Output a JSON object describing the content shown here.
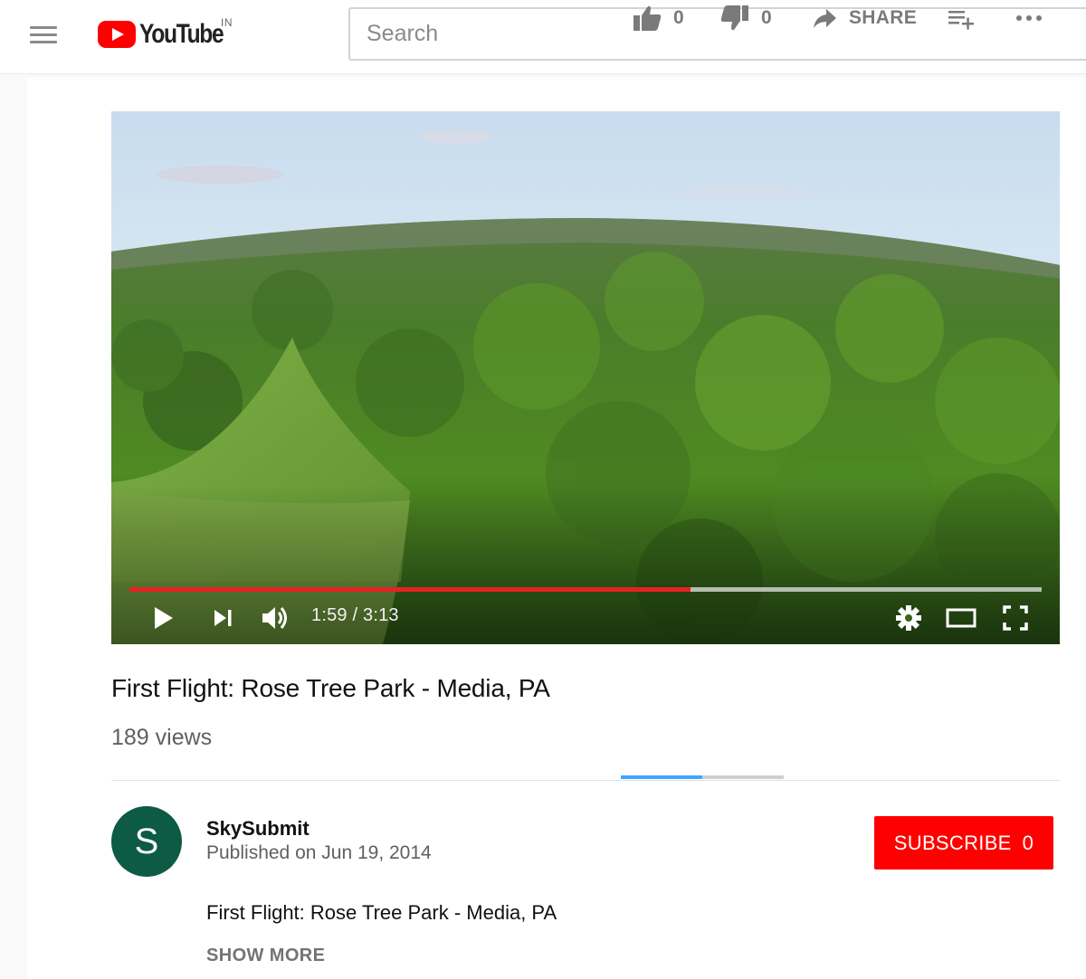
{
  "masthead": {
    "logo_text": "YouTube",
    "country_code": "IN",
    "search_placeholder": "Search"
  },
  "player": {
    "current_time": "1:59",
    "duration": "3:13",
    "time_display": "1:59 / 3:13",
    "progress_fraction": 0.615,
    "controls": [
      "play-icon",
      "next-icon",
      "volume-icon",
      "gear-icon",
      "theater-icon",
      "fullscreen-icon"
    ]
  },
  "video": {
    "title": "First Flight: Rose Tree Park - Media, PA",
    "views": "189 views",
    "like_count": "0",
    "dislike_count": "0",
    "share_label": "SHARE",
    "sentiment_like_fraction": 0.5
  },
  "owner": {
    "avatar_letter": "S",
    "channel_name": "SkySubmit",
    "published": "Published on Jun 19, 2014",
    "subscribe_label": "SUBSCRIBE",
    "subscriber_count": "0"
  },
  "description": {
    "text": "First Flight: Rose Tree Park - Media, PA",
    "show_more": "SHOW MORE"
  },
  "colors": {
    "brand_red": "#ff0000",
    "progress_red": "#e52222",
    "avatar_green": "#0d5a45",
    "like_blue": "#3ea6ff"
  }
}
